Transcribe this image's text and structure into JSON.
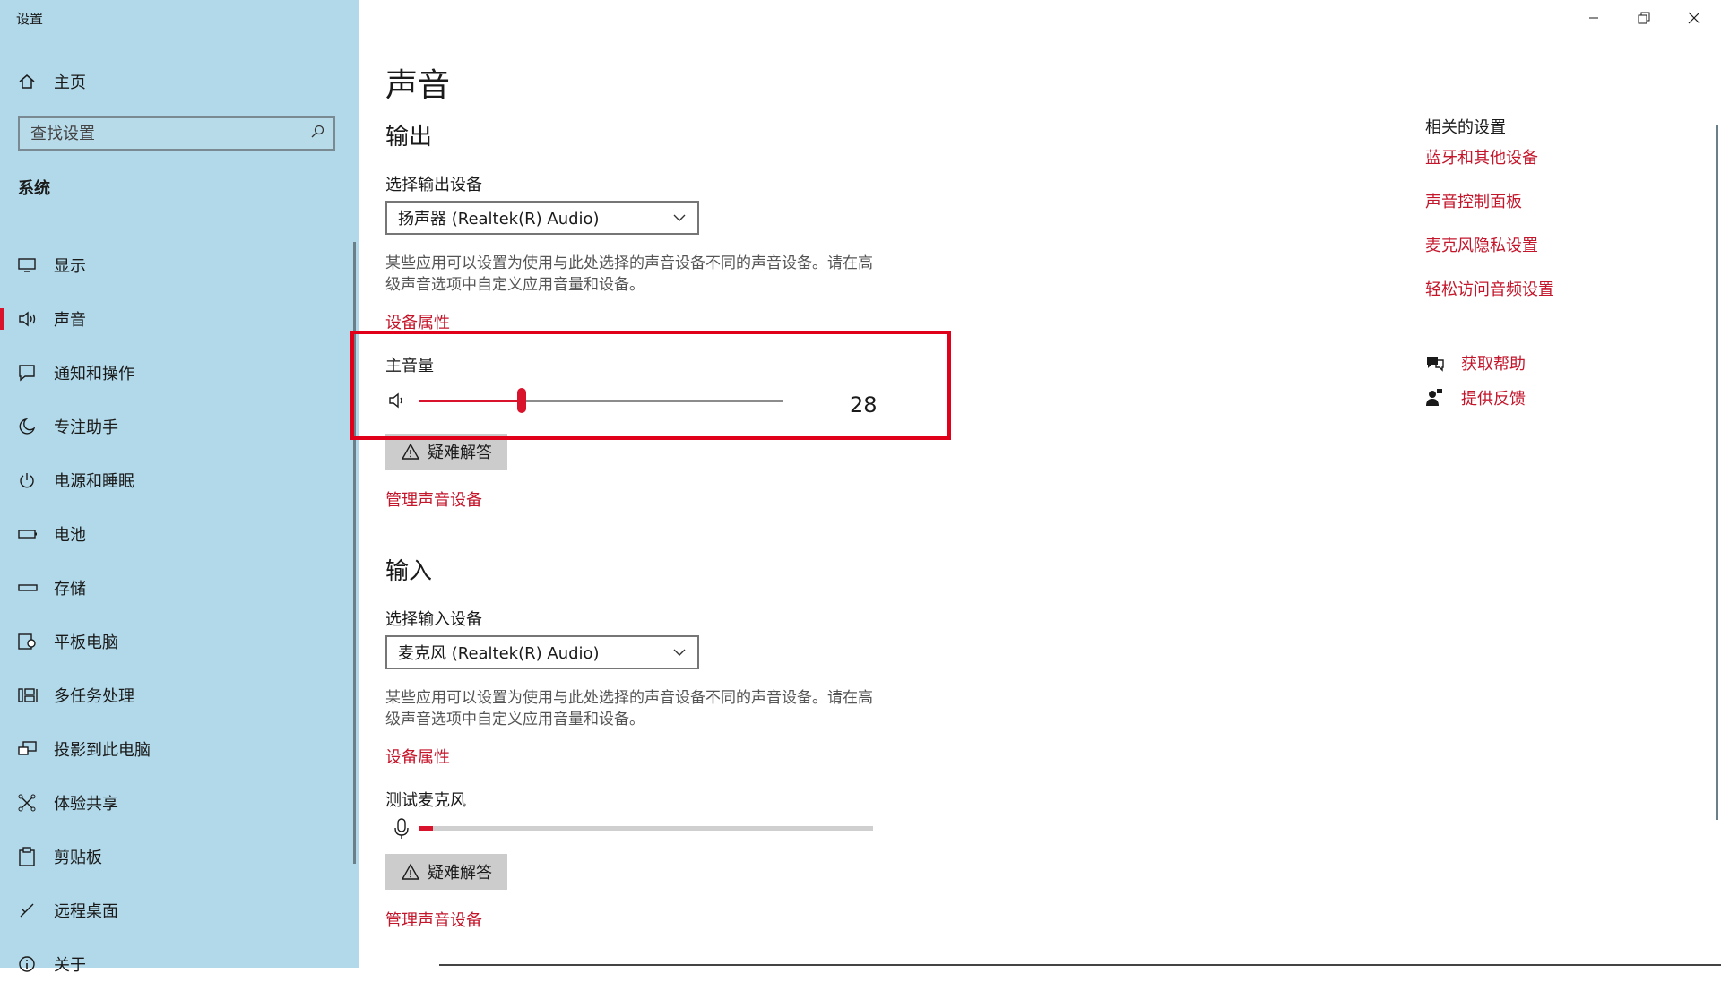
{
  "window": {
    "title": "设置"
  },
  "sidebar": {
    "home_label": "主页",
    "search_placeholder": "查找设置",
    "section_title": "系统",
    "items": [
      {
        "label": "显示",
        "icon": "monitor-icon"
      },
      {
        "label": "声音",
        "icon": "speaker-icon",
        "active": true
      },
      {
        "label": "通知和操作",
        "icon": "notification-icon"
      },
      {
        "label": "专注助手",
        "icon": "moon-icon"
      },
      {
        "label": "电源和睡眠",
        "icon": "power-icon"
      },
      {
        "label": "电池",
        "icon": "battery-icon"
      },
      {
        "label": "存储",
        "icon": "storage-icon"
      },
      {
        "label": "平板电脑",
        "icon": "tablet-icon"
      },
      {
        "label": "多任务处理",
        "icon": "multitask-icon"
      },
      {
        "label": "投影到此电脑",
        "icon": "project-icon"
      },
      {
        "label": "体验共享",
        "icon": "share-icon"
      },
      {
        "label": "剪贴板",
        "icon": "clipboard-icon"
      },
      {
        "label": "远程桌面",
        "icon": "remote-icon"
      },
      {
        "label": "关于",
        "icon": "info-icon"
      }
    ]
  },
  "main": {
    "page_title": "声音",
    "output": {
      "heading": "输出",
      "select_label": "选择输出设备",
      "device": "扬声器 (Realtek(R) Audio)",
      "description_line1": "某些应用可以设置为使用与此处选择的声音设备不同的声音设备。请在高",
      "description_line2": "级声音选项中自定义应用音量和设备。",
      "properties_link": "设备属性",
      "master_volume_label": "主音量",
      "volume": 28,
      "troubleshoot_label": "疑难解答",
      "manage_link": "管理声音设备"
    },
    "input": {
      "heading": "输入",
      "select_label": "选择输入设备",
      "device": "麦克风 (Realtek(R) Audio)",
      "description_line1": "某些应用可以设置为使用与此处选择的声音设备不同的声音设备。请在高",
      "description_line2": "级声音选项中自定义应用音量和设备。",
      "properties_link": "设备属性",
      "test_mic_label": "测试麦克风",
      "mic_level_fraction": 0.03,
      "troubleshoot_label": "疑难解答",
      "manage_link": "管理声音设备"
    }
  },
  "related": {
    "title": "相关的设置",
    "links": [
      "蓝牙和其他设备",
      "声音控制面板",
      "麦克风隐私设置",
      "轻松访问音频设置"
    ],
    "help_label": "获取帮助",
    "feedback_label": "提供反馈"
  },
  "colors": {
    "accent": "#c4162b",
    "sidebar_bg": "#b1d9ea",
    "highlight": "#e0001a"
  }
}
